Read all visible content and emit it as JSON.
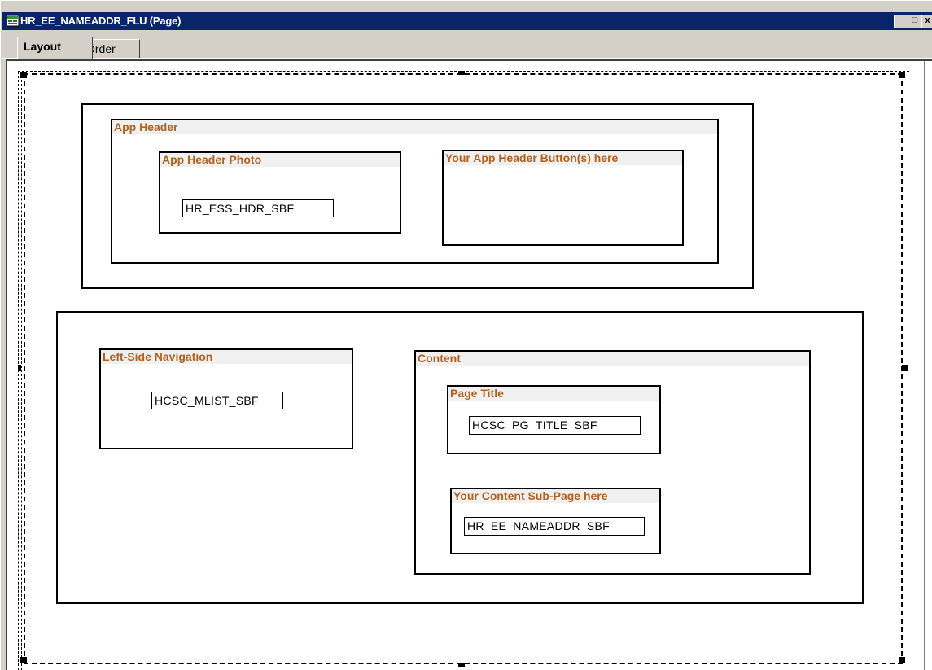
{
  "window": {
    "title": "HR_EE_NAMEADDR_FLU (Page)",
    "controls": {
      "minimize": "_",
      "restore": "□",
      "close": "x"
    }
  },
  "tabs": [
    {
      "label": "Layout",
      "active": true
    },
    {
      "label": "Order",
      "active": false
    }
  ],
  "page": {
    "app_header_group": {
      "label": "App Header",
      "photo": {
        "label": "App Header Photo",
        "field": "HR_ESS_HDR_SBF"
      },
      "buttons": {
        "label": "Your App Header Button(s) here"
      }
    },
    "left_nav": {
      "label": "Left-Side Navigation",
      "field": "HCSC_MLIST_SBF"
    },
    "content": {
      "label": "Content",
      "page_title": {
        "label": "Page Title",
        "field": "HCSC_PG_TITLE_SBF"
      },
      "subpage": {
        "label": "Your Content Sub-Page here",
        "field": "HR_EE_NAMEADDR_SBF"
      }
    }
  },
  "colors": {
    "titlebar": "#0a246a",
    "label_text": "#b5601c",
    "label_bg": "#f0f0f0",
    "chrome": "#d4d0c8"
  }
}
